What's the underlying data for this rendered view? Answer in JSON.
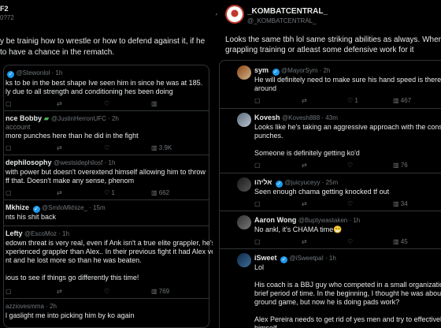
{
  "left": {
    "header_name": "F2",
    "header_handle": "0?72",
    "post_lines": [
      "y be trainig how to wrestle or how to defend against it, if he",
      " to have a chance in the rematch."
    ],
    "replies": [
      {
        "handle": "@Stewonlol · 1h",
        "lines": [
          "ks to be in the best shape Ive seen him in since he was at 185.",
          "ly due to all strength and conditioning hes been doing"
        ],
        "stats": {
          "views": ""
        }
      },
      {
        "name": "nce Bobby",
        "handle": "@JustinHerronUFC · 2h",
        "sub": "account",
        "lines": [
          "more punches here than he did in the fight"
        ],
        "stats": {
          "views": "3.9K"
        }
      },
      {
        "name": "dephilosophy",
        "handle": "@westsidephilosf · 1h",
        "lines": [
          " with power but doesn't overextend himself allowing him to throw",
          "ff that. Doesn't make any sense, phenom"
        ],
        "stats": {
          "likes": "1",
          "views": "662"
        }
      },
      {
        "name": "Mkhize",
        "handle": "@SmiloMkhize_ · 15m",
        "lines": [
          "nts his shit back"
        ],
        "stats": {}
      },
      {
        "name": "Lefty",
        "handle": "@EscoMoz · 1h",
        "lines": [
          "edown threat is very real, even if Ank isn't a true elite grappler, he's a",
          "xperienced grappler than Alex.. In their previous fight it had Alex very",
          "nt and he lost more so than he was beaten.",
          "",
          "ious to see if things go differently this time!"
        ],
        "stats": {
          "views": "769"
        }
      },
      {
        "handle": "azziovesmma · 2h",
        "lines": [
          "l gaslight me into picking him by ko again"
        ],
        "stats": {}
      }
    ]
  },
  "right": {
    "op_name": "_KOMBATCENTRAL_",
    "op_handle": "@_KOMBATCENTRAL_",
    "op_lines": [
      "Looks the same tbh lol same striking abilities as always. Where",
      "grappling training or atleast some defensive work for it"
    ],
    "replies": [
      {
        "name": "sym",
        "handle": "@MayorSym · 2h",
        "lines": [
          "He will definitely need to make sure his hand speed is there this time",
          "around"
        ],
        "stats": {
          "replies": "",
          "reposts": "",
          "likes": "1",
          "views": "467"
        }
      },
      {
        "name": "Kovesh",
        "handle": "@Kovesh888 · 43m",
        "lines": [
          "Looks like he's taking an aggressive approach with the consecutive",
          "punches.",
          "",
          "Someone is definitely getting ko'd"
        ],
        "stats": {
          "views": "76"
        }
      },
      {
        "name": "אליהו",
        "handle": "@juicyuceyy · 25m",
        "lines": [
          "Seen enough chama getting knocked tf out"
        ],
        "stats": {
          "views": "34"
        }
      },
      {
        "name": "Aaron Wong",
        "handle": "@Buptywastaken · 1h",
        "lines": [
          "No ankl, it's CHAMA time😁"
        ],
        "stats": {
          "views": "45"
        }
      },
      {
        "name": "iSweet",
        "handle": "@iSweetpaI · 1h",
        "lines": [
          "Lol",
          "",
          "His coach is a BBJ guy who competed in a small organization CFFC for a",
          "brief period of time. In the beginning, I thought he was about to improve his",
          "ground game, but now he is doing pads work?",
          "",
          "Alex Pereira needs to get rid of yes men and try to effectively improve",
          "himself"
        ],
        "stats": {}
      }
    ]
  },
  "colors": {
    "bg": "#000000",
    "text": "#e7e9ea",
    "muted": "#71767b",
    "accent": "#1d9bf0",
    "border": "#2f3336"
  },
  "icons": [
    "more-icon",
    "verified-badge-icon",
    "reply-icon",
    "repost-icon",
    "like-icon",
    "views-icon",
    "bookmark-icon",
    "share-icon"
  ]
}
